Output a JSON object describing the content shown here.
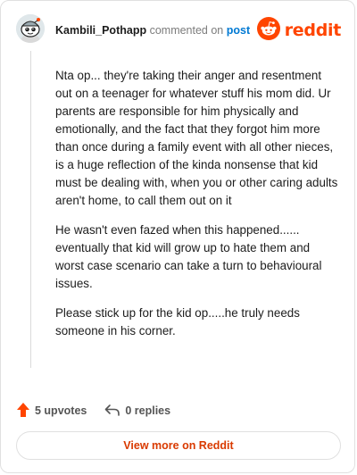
{
  "header": {
    "username": "Kambili_Pothapp",
    "action_text": "commented on",
    "post_link": "post",
    "brand": "reddit",
    "avatar_icon": "snoo-avatar-icon",
    "brand_icon": "reddit-logo-icon",
    "brand_color": "#ff4500"
  },
  "comment": {
    "paragraphs": [
      "Nta op... they're taking their anger and resentment out on a teenager for whatever stuff his mom did. Ur parents are responsible for him physically and emotionally, and the fact that they forgot him more than once during a family event with all other nieces, is a huge reflection of the kinda nonsense that kid must be dealing with, when you or other caring adults aren't home, to call them out on it",
      "He wasn't even fazed when this happened...... eventually that kid will grow up to hate them and worst case scenario can take a turn to behavioural issues.",
      "Please stick up for the kid op.....he truly needs someone in his corner."
    ]
  },
  "actions": {
    "upvotes": "5 upvotes",
    "replies": "0 replies",
    "upvote_icon": "upvote-arrow-icon",
    "reply_icon": "reply-arrow-icon",
    "upvote_color": "#ff4500"
  },
  "footer": {
    "view_more": "View more on Reddit",
    "link_color": "#d93a00"
  }
}
